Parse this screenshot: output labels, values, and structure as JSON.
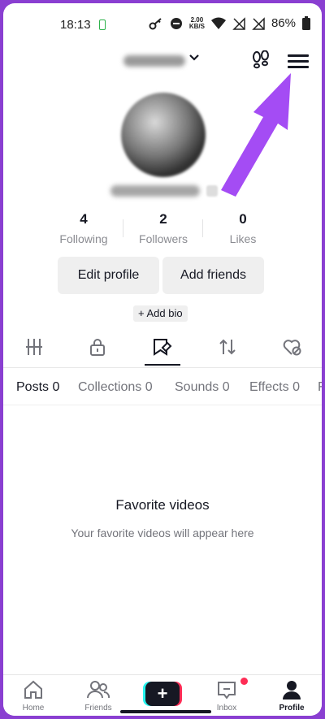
{
  "status": {
    "time": "18:13",
    "speed_value": "2.00",
    "speed_unit": "KB/S",
    "battery": "86%"
  },
  "profile": {
    "stats": [
      {
        "count": "4",
        "label": "Following"
      },
      {
        "count": "2",
        "label": "Followers"
      },
      {
        "count": "0",
        "label": "Likes"
      }
    ],
    "edit_profile": "Edit profile",
    "add_friends": "Add friends",
    "add_bio": "+ Add bio"
  },
  "icon_tabs": [
    "grid-icon",
    "lock-icon",
    "bookmark-icon",
    "repost-icon",
    "liked-icon"
  ],
  "content_tabs": [
    "Posts 0",
    "Collections 0",
    "Sounds 0",
    "Effects 0",
    "F"
  ],
  "empty_state": {
    "title": "Favorite videos",
    "subtitle": "Your favorite videos will appear here"
  },
  "nav": {
    "home": "Home",
    "friends": "Friends",
    "create": "+",
    "inbox": "Inbox",
    "profile": "Profile"
  },
  "colors": {
    "frame": "#8a3fd1",
    "annotation_arrow": "#a44cf4",
    "accent_red": "#fe2c55",
    "accent_cyan": "#25f4ee"
  }
}
